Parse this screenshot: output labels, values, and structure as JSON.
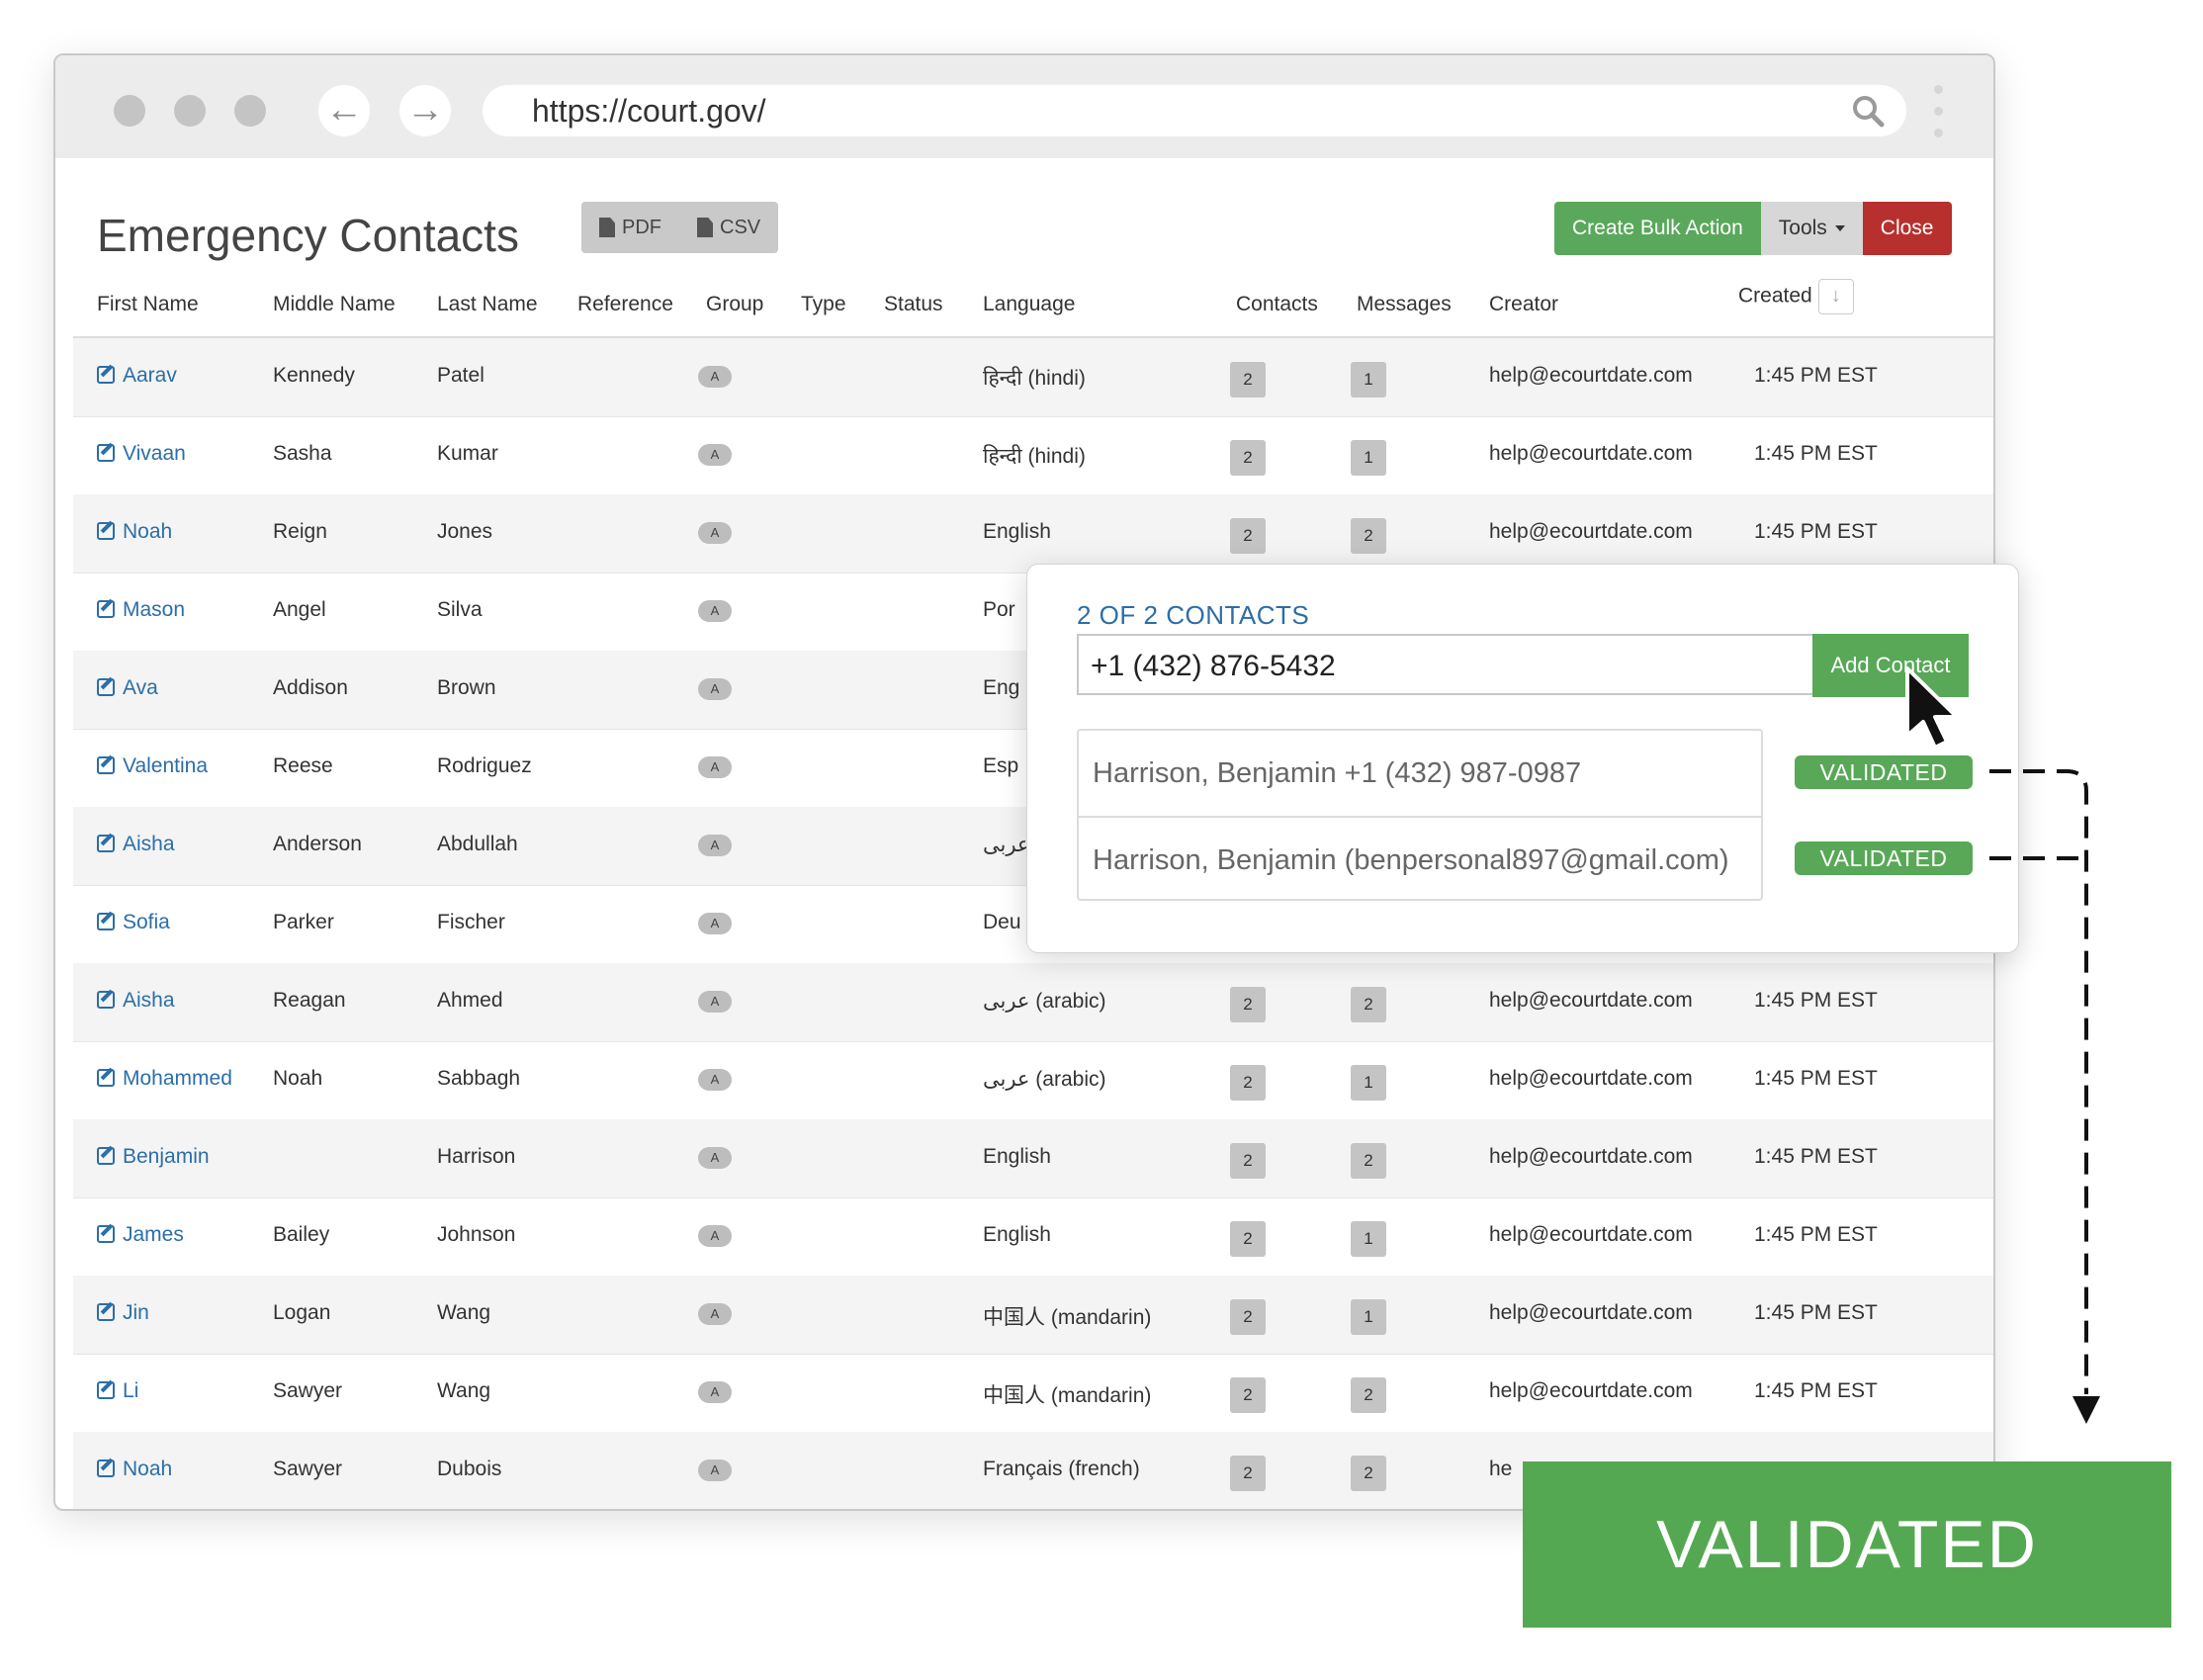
{
  "browser": {
    "url": "https://court.gov/",
    "back_icon": "arrow-left-icon",
    "forward_icon": "arrow-right-icon",
    "search_icon": "search-icon"
  },
  "page": {
    "title": "Emergency Contacts",
    "export": {
      "pdf": "PDF",
      "csv": "CSV"
    },
    "toolbar": {
      "bulk": "Create Bulk Action",
      "tools": "Tools",
      "close": "Close"
    }
  },
  "table": {
    "headers": [
      "First Name",
      "Middle Name",
      "Last Name",
      "Reference",
      "Group",
      "Type",
      "Status",
      "Language",
      "Contacts",
      "Messages",
      "Creator",
      "Created"
    ],
    "rows": [
      {
        "first": "Aarav",
        "middle": "Kennedy",
        "last": "Patel",
        "group": "A",
        "language": "हिन्दी (hindi)",
        "contacts": "2",
        "messages": "1",
        "creator": "help@ecourtdate.com",
        "created": "1:45 PM EST"
      },
      {
        "first": "Vivaan",
        "middle": "Sasha",
        "last": "Kumar",
        "group": "A",
        "language": "हिन्दी (hindi)",
        "contacts": "2",
        "messages": "1",
        "creator": "help@ecourtdate.com",
        "created": "1:45 PM EST"
      },
      {
        "first": "Noah",
        "middle": "Reign",
        "last": "Jones",
        "group": "A",
        "language": "English",
        "contacts": "2",
        "messages": "2",
        "creator": "help@ecourtdate.com",
        "created": "1:45 PM EST"
      },
      {
        "first": "Mason",
        "middle": "Angel",
        "last": "Silva",
        "group": "A",
        "language": "Por",
        "contacts": "",
        "messages": "",
        "creator": "",
        "created": ""
      },
      {
        "first": "Ava",
        "middle": "Addison",
        "last": "Brown",
        "group": "A",
        "language": "Eng",
        "contacts": "",
        "messages": "",
        "creator": "",
        "created": ""
      },
      {
        "first": "Valentina",
        "middle": "Reese",
        "last": "Rodriguez",
        "group": "A",
        "language": "Esp",
        "contacts": "",
        "messages": "",
        "creator": "",
        "created": ""
      },
      {
        "first": "Aisha",
        "middle": "Anderson",
        "last": "Abdullah",
        "group": "A",
        "language": "عربی",
        "contacts": "",
        "messages": "",
        "creator": "",
        "created": ""
      },
      {
        "first": "Sofia",
        "middle": "Parker",
        "last": "Fischer",
        "group": "A",
        "language": "Deu",
        "contacts": "",
        "messages": "",
        "creator": "",
        "created": ""
      },
      {
        "first": "Aisha",
        "middle": "Reagan",
        "last": "Ahmed",
        "group": "A",
        "language": "عربى (arabic)",
        "contacts": "2",
        "messages": "2",
        "creator": "help@ecourtdate.com",
        "created": "1:45 PM EST"
      },
      {
        "first": "Mohammed",
        "middle": "Noah",
        "last": "Sabbagh",
        "group": "A",
        "language": "عربى (arabic)",
        "contacts": "2",
        "messages": "1",
        "creator": "help@ecourtdate.com",
        "created": "1:45 PM EST"
      },
      {
        "first": "Benjamin",
        "middle": "",
        "last": "Harrison",
        "group": "A",
        "language": "English",
        "contacts": "2",
        "messages": "2",
        "creator": "help@ecourtdate.com",
        "created": "1:45 PM EST"
      },
      {
        "first": "James",
        "middle": "Bailey",
        "last": "Johnson",
        "group": "A",
        "language": "English",
        "contacts": "2",
        "messages": "1",
        "creator": "help@ecourtdate.com",
        "created": "1:45 PM EST"
      },
      {
        "first": "Jin",
        "middle": "Logan",
        "last": "Wang",
        "group": "A",
        "language": "中国人 (mandarin)",
        "contacts": "2",
        "messages": "1",
        "creator": "help@ecourtdate.com",
        "created": "1:45 PM EST"
      },
      {
        "first": "Li",
        "middle": "Sawyer",
        "last": "Wang",
        "group": "A",
        "language": "中国人 (mandarin)",
        "contacts": "2",
        "messages": "2",
        "creator": "help@ecourtdate.com",
        "created": "1:45 PM EST"
      },
      {
        "first": "Noah",
        "middle": "Sawyer",
        "last": "Dubois",
        "group": "A",
        "language": "Français (french)",
        "contacts": "2",
        "messages": "2",
        "creator": "he",
        "created": ""
      }
    ]
  },
  "popup": {
    "header": "2 OF 2 CONTACTS",
    "phone_value": "+1 (432) 876-5432",
    "add_button": "Add Contact",
    "contacts": [
      {
        "label": "Harrison, Benjamin +1 (432) 987-0987",
        "status": "VALIDATED"
      },
      {
        "label": "Harrison, Benjamin (benpersonal897@gmail.com)",
        "status": "VALIDATED"
      }
    ]
  },
  "big_badge": "VALIDATED",
  "colors": {
    "green": "#58a857",
    "red": "#b7302e",
    "link": "#2c6ea8"
  }
}
